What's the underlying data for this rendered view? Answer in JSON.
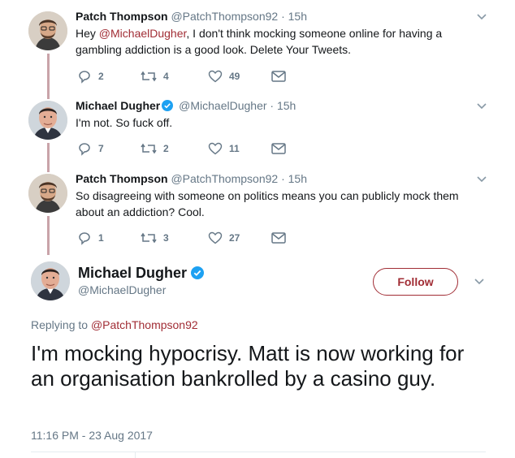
{
  "tweets": [
    {
      "name": "Patch Thompson",
      "handle": "@PatchThompson92",
      "sep": "·",
      "time": "15h",
      "text_before": "Hey ",
      "mention": "@MichaelDugher",
      "text_after": ", I don't think mocking someone online for having a gambling addiction is a good look. Delete Your Tweets.",
      "replies": "2",
      "retweets": "4",
      "likes": "49"
    },
    {
      "name": "Michael Dugher",
      "handle": "@MichaelDugher",
      "sep": "·",
      "time": "15h",
      "text": "I'm not. So fuck off.",
      "replies": "7",
      "retweets": "2",
      "likes": "11"
    },
    {
      "name": "Patch Thompson",
      "handle": "@PatchThompson92",
      "sep": "·",
      "time": "15h",
      "text": "So disagreeing with someone on politics means you can publicly mock them about an addiction? Cool.",
      "replies": "1",
      "retweets": "3",
      "likes": "27"
    }
  ],
  "main_tweet": {
    "name": "Michael Dugher",
    "handle": "@MichaelDugher",
    "follow_label": "Follow",
    "replying_prefix": "Replying to ",
    "replying_to": "@PatchThompson92",
    "text": "I'm mocking hypocrisy. Matt is now working for an organisation bankrolled by a casino guy.",
    "timestamp": "11:16 PM - 23 Aug 2017"
  },
  "colors": {
    "accent": "#a12d35",
    "muted": "#657786",
    "thread_line": "#c9a3a9",
    "verified": "#1da1f2"
  },
  "icons": [
    "reply-icon",
    "retweet-icon",
    "like-icon",
    "message-icon",
    "chevron-down-icon",
    "verified-badge-icon"
  ]
}
